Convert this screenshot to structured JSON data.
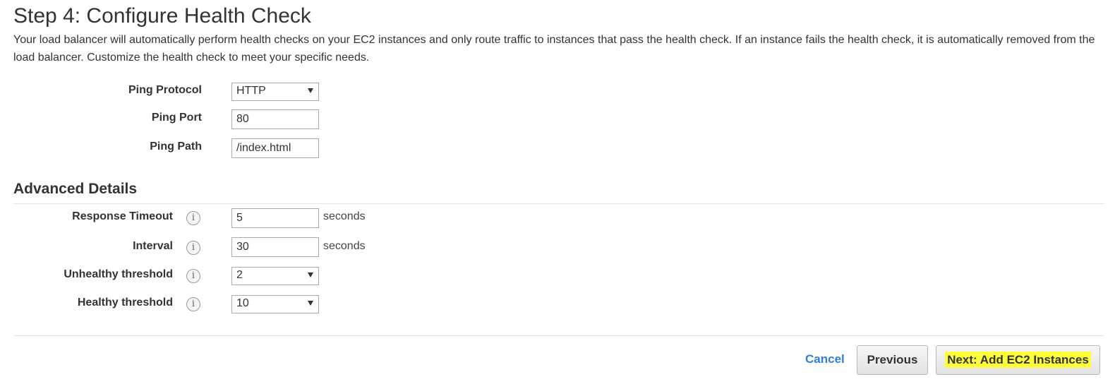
{
  "page": {
    "title": "Step 4: Configure Health Check",
    "description": "Your load balancer will automatically perform health checks on your EC2 instances and only route traffic to instances that pass the health check. If an instance fails the health check, it is automatically removed from the load balancer. Customize the health check to meet your specific needs."
  },
  "ping": {
    "protocol_label": "Ping Protocol",
    "protocol_value": "HTTP",
    "port_label": "Ping Port",
    "port_value": "80",
    "path_label": "Ping Path",
    "path_value": "/index.html"
  },
  "advanced": {
    "title": "Advanced Details",
    "response_timeout_label": "Response Timeout",
    "response_timeout_value": "5",
    "response_timeout_unit": "seconds",
    "interval_label": "Interval",
    "interval_value": "30",
    "interval_unit": "seconds",
    "unhealthy_label": "Unhealthy threshold",
    "unhealthy_value": "2",
    "healthy_label": "Healthy threshold",
    "healthy_value": "10",
    "info_glyph": "i"
  },
  "footer": {
    "cancel_label": "Cancel",
    "previous_label": "Previous",
    "next_label": "Next: Add EC2 Instances",
    "highlight_color": "#ffff3a",
    "link_color": "#2f7ed8"
  },
  "icons": {
    "info": "info-icon",
    "dropdown": "chevron-down-icon"
  }
}
